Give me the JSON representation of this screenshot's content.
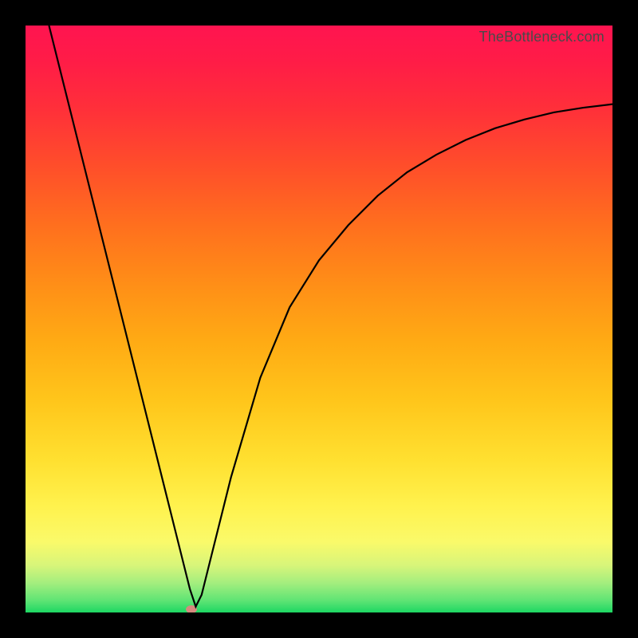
{
  "watermark": "TheBottleneck.com",
  "colors": {
    "frame": "#000000",
    "curve": "#000000",
    "marker": "#d58a7e"
  },
  "chart_data": {
    "type": "line",
    "title": "",
    "xlabel": "",
    "ylabel": "",
    "xlim": [
      0,
      100
    ],
    "ylim": [
      0,
      100
    ],
    "grid": false,
    "legend": false,
    "series": [
      {
        "name": "bottleneck-curve",
        "x": [
          4,
          8,
          12,
          16,
          20,
          24,
          27,
          28,
          29,
          30,
          32,
          35,
          40,
          45,
          50,
          55,
          60,
          65,
          70,
          75,
          80,
          85,
          90,
          95,
          100
        ],
        "y": [
          100,
          84,
          68,
          52,
          36,
          20,
          8,
          4,
          1,
          3,
          11,
          23,
          40,
          52,
          60,
          66,
          71,
          75,
          78,
          80.5,
          82.5,
          84,
          85.2,
          86,
          86.6
        ]
      }
    ],
    "marker": {
      "x": 28.3,
      "y": 0.6
    },
    "annotations": [],
    "background_gradient": {
      "orientation": "vertical",
      "stops": [
        {
          "pos": 0.0,
          "color": "#ff1450"
        },
        {
          "pos": 0.5,
          "color": "#ffab14"
        },
        {
          "pos": 0.85,
          "color": "#fff24e"
        },
        {
          "pos": 1.0,
          "color": "#1dd763"
        }
      ]
    }
  }
}
